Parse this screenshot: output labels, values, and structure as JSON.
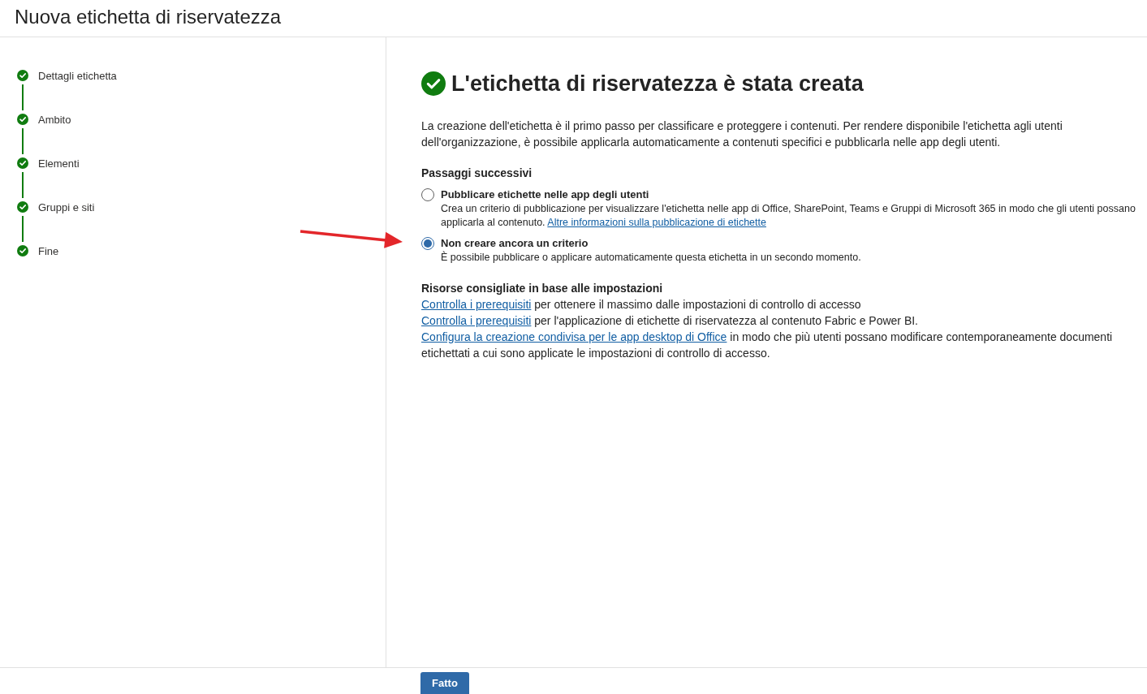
{
  "header": {
    "title": "Nuova etichetta di riservatezza"
  },
  "steps": [
    {
      "label": "Dettagli etichetta",
      "completed": true
    },
    {
      "label": "Ambito",
      "completed": true
    },
    {
      "label": "Elementi",
      "completed": true
    },
    {
      "label": "Gruppi e siti",
      "completed": true
    },
    {
      "label": "Fine",
      "completed": true
    }
  ],
  "result": {
    "title": "L'etichetta di riservatezza è stata creata",
    "description": "La creazione dell'etichetta è il primo passo per classificare e proteggere i contenuti. Per rendere disponibile l'etichetta agli utenti dell'organizzazione, è possibile applicarla automaticamente a contenuti specifici e pubblicarla nelle app degli utenti."
  },
  "next_steps": {
    "heading": "Passaggi successivi",
    "options": [
      {
        "label": "Pubblicare etichette nelle app degli utenti",
        "description": "Crea un criterio di pubblicazione per visualizzare l'etichetta nelle app di Office, SharePoint, Teams e Gruppi di Microsoft 365 in modo che gli utenti possano applicarla al contenuto.",
        "link": "Altre informazioni sulla pubblicazione di etichette",
        "selected": false
      },
      {
        "label": "Non creare ancora un criterio",
        "description": "È possibile pubblicare o applicare automaticamente questa etichetta in un secondo momento.",
        "selected": true
      }
    ]
  },
  "resources": {
    "heading": "Risorse consigliate in base alle impostazioni",
    "items": [
      {
        "link": "Controlla i prerequisiti",
        "text": "per ottenere il massimo dalle impostazioni di controllo di accesso"
      },
      {
        "link": "Controlla i prerequisiti",
        "text": "per l'applicazione di etichette di riservatezza al contenuto Fabric e Power BI."
      },
      {
        "link": "Configura la creazione condivisa per le app desktop di Office",
        "text": "in modo che più utenti possano modificare contemporaneamente documenti etichettati a cui sono applicate le impostazioni di controllo di accesso."
      }
    ]
  },
  "footer": {
    "buttons": [
      "Fatto"
    ]
  }
}
